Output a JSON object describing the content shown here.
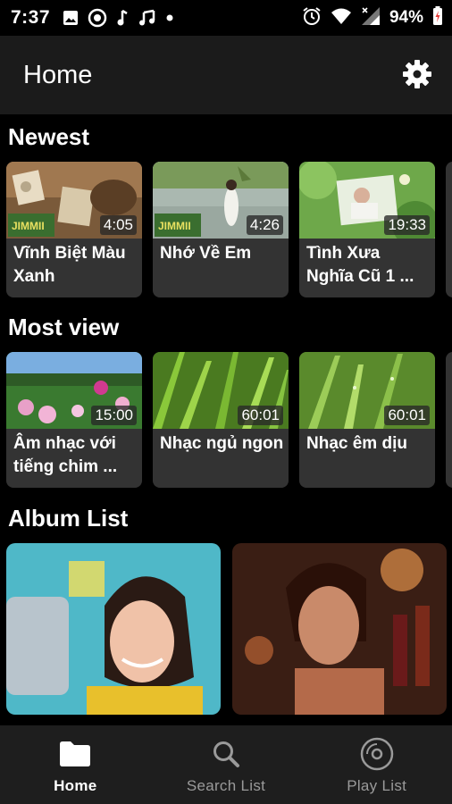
{
  "status_bar": {
    "time": "7:37",
    "battery": "94%"
  },
  "app_bar": {
    "title": "Home"
  },
  "sections": {
    "newest": {
      "title": "Newest",
      "items": [
        {
          "title": "Vĩnh Biệt Màu Xanh",
          "duration": "4:05"
        },
        {
          "title": "Nhớ Về Em",
          "duration": "4:26"
        },
        {
          "title": "Tình Xưa Nghĩa Cũ 1 ...",
          "duration": "19:33"
        }
      ]
    },
    "most_view": {
      "title": "Most view",
      "items": [
        {
          "title": "Âm nhạc với tiếng chim ...",
          "duration": "15:00"
        },
        {
          "title": "Nhạc ngủ ngon",
          "duration": "60:01"
        },
        {
          "title": "Nhạc êm dịu",
          "duration": "60:01"
        }
      ]
    },
    "album_list": {
      "title": "Album List"
    }
  },
  "bottom_nav": {
    "items": [
      {
        "label": "Home",
        "icon": "folder-icon",
        "active": true
      },
      {
        "label": "Search List",
        "icon": "search-icon",
        "active": false
      },
      {
        "label": "Play List",
        "icon": "disc-icon",
        "active": false
      }
    ]
  },
  "colors": {
    "background": "#000000",
    "app_bar": "#1b1b1b",
    "card": "#333333",
    "nav_bar": "#1e1e1e"
  }
}
